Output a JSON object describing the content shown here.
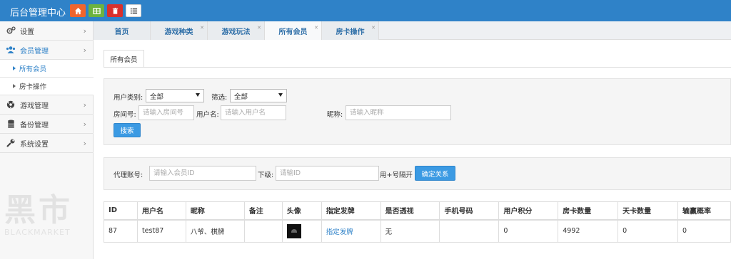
{
  "app": {
    "title": "后台管理中心"
  },
  "toolbar": [
    {
      "icon": "home-icon",
      "color": "#f0652d"
    },
    {
      "icon": "grid-icon",
      "color": "#6cb33f"
    },
    {
      "icon": "trash-icon",
      "color": "#d9302c"
    },
    {
      "icon": "list-icon",
      "color": "#ffffff"
    }
  ],
  "sidebar": {
    "settings": "设置",
    "members": "会员管理",
    "all_members": "所有会员",
    "card_ops": "房卡操作",
    "game_mgmt": "游戏管理",
    "backup": "备份管理",
    "system": "系统设置"
  },
  "tabs": [
    "首页",
    "游戏种类",
    "游戏玩法",
    "所有会员",
    "房卡操作"
  ],
  "subtab": "所有会员",
  "filters": {
    "user_type_label": "用户类别:",
    "user_type_value": "全部",
    "filter_label": "筛选:",
    "filter_value": "全部",
    "room_label": "房间号:",
    "room_placeholder": "请输入房间号",
    "username_label": "用户名:",
    "username_placeholder": "请输入用户名",
    "nickname_label": "昵称:",
    "nickname_placeholder": "请输入昵称",
    "search_button": "搜索"
  },
  "agent": {
    "account_label": "代理账号:",
    "account_placeholder": "请输入会员ID",
    "sub_label": "下级:",
    "sub_placeholder": "请输ID",
    "separator_note": "用+号隔开",
    "bind_button": "确定关系"
  },
  "table": {
    "headers": [
      "ID",
      "用户名",
      "昵称",
      "备注",
      "头像",
      "指定发牌",
      "是否透视",
      "手机号码",
      "用户积分",
      "房卡数量",
      "天卡数量",
      "输赢概率"
    ],
    "rows": [
      {
        "id": "87",
        "username": "test87",
        "nickname": "八爷、棋牌",
        "note": "",
        "deal": "指定发牌",
        "xray": "无",
        "phone": "",
        "points": "0",
        "cards": "4992",
        "day_cards": "0",
        "win_rate": "0"
      }
    ]
  },
  "watermark": {
    "big": "黑市",
    "small": "BLACKMARKET"
  }
}
